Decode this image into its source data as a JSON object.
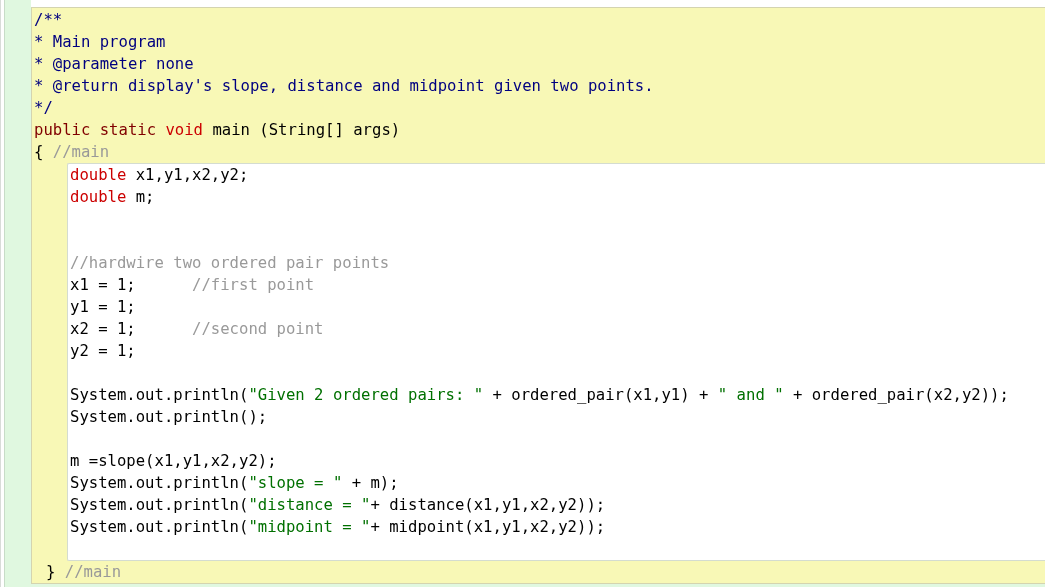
{
  "method": {
    "header": [
      {
        "kind": "code",
        "tokens": [
          {
            "kind": "javadoc",
            "text": "/**"
          }
        ]
      },
      {
        "kind": "code",
        "tokens": [
          {
            "kind": "javadoc",
            "text": "* Main program"
          }
        ]
      },
      {
        "kind": "code",
        "tokens": [
          {
            "kind": "javadoc",
            "text": "* @parameter none"
          }
        ]
      },
      {
        "kind": "code",
        "tokens": [
          {
            "kind": "javadoc",
            "text": "* @return display's slope, distance and midpoint given two points."
          }
        ]
      },
      {
        "kind": "code",
        "tokens": [
          {
            "kind": "javadoc",
            "text": "*/"
          }
        ]
      },
      {
        "kind": "code",
        "tokens": [
          {
            "kind": "modifier",
            "text": "public static "
          },
          {
            "kind": "type",
            "text": "void"
          },
          {
            "kind": "plain",
            "text": " main (String[] args)"
          }
        ]
      },
      {
        "kind": "code",
        "tokens": [
          {
            "kind": "plain",
            "text": "{ "
          },
          {
            "kind": "comment",
            "text": "//main"
          }
        ]
      }
    ],
    "body": [
      {
        "kind": "code",
        "tokens": [
          {
            "kind": "type",
            "text": "double"
          },
          {
            "kind": "plain",
            "text": " x1,y1,x2,y2;"
          }
        ]
      },
      {
        "kind": "code",
        "tokens": [
          {
            "kind": "type",
            "text": "double"
          },
          {
            "kind": "plain",
            "text": " m;"
          }
        ]
      },
      {
        "kind": "blank"
      },
      {
        "kind": "blank"
      },
      {
        "kind": "code",
        "tokens": [
          {
            "kind": "comment",
            "text": "//hardwire two ordered pair points"
          }
        ]
      },
      {
        "kind": "code",
        "tokens": [
          {
            "kind": "plain",
            "text": "x1 = 1;      "
          },
          {
            "kind": "comment",
            "text": "//first point"
          }
        ]
      },
      {
        "kind": "code",
        "tokens": [
          {
            "kind": "plain",
            "text": "y1 = 1;"
          }
        ]
      },
      {
        "kind": "code",
        "tokens": [
          {
            "kind": "plain",
            "text": "x2 = 1;      "
          },
          {
            "kind": "comment",
            "text": "//second point"
          }
        ]
      },
      {
        "kind": "code",
        "tokens": [
          {
            "kind": "plain",
            "text": "y2 = 1;"
          }
        ]
      },
      {
        "kind": "blank"
      },
      {
        "kind": "code",
        "tokens": [
          {
            "kind": "plain",
            "text": "System.out.println("
          },
          {
            "kind": "string",
            "text": "\"Given 2 ordered pairs: \""
          },
          {
            "kind": "plain",
            "text": " + ordered_pair(x1,y1) + "
          },
          {
            "kind": "string",
            "text": "\" and \""
          },
          {
            "kind": "plain",
            "text": " + ordered_pair(x2,y2));"
          }
        ]
      },
      {
        "kind": "code",
        "tokens": [
          {
            "kind": "plain",
            "text": "System.out.println();"
          }
        ]
      },
      {
        "kind": "blank"
      },
      {
        "kind": "code",
        "tokens": [
          {
            "kind": "plain",
            "text": "m =slope(x1,y1,x2,y2);"
          }
        ]
      },
      {
        "kind": "code",
        "tokens": [
          {
            "kind": "plain",
            "text": "System.out.println("
          },
          {
            "kind": "string",
            "text": "\"slope = \""
          },
          {
            "kind": "plain",
            "text": " + m);"
          }
        ]
      },
      {
        "kind": "code",
        "tokens": [
          {
            "kind": "plain",
            "text": "System.out.println("
          },
          {
            "kind": "string",
            "text": "\"distance = \""
          },
          {
            "kind": "plain",
            "text": "+ distance(x1,y1,x2,y2));"
          }
        ]
      },
      {
        "kind": "code",
        "tokens": [
          {
            "kind": "plain",
            "text": "System.out.println("
          },
          {
            "kind": "string",
            "text": "\"midpoint = \""
          },
          {
            "kind": "plain",
            "text": "+ midpoint(x1,y1,x2,y2));"
          }
        ]
      },
      {
        "kind": "blank"
      }
    ],
    "footer": [
      {
        "kind": "code",
        "tokens": [
          {
            "kind": "plain",
            "text": "} "
          },
          {
            "kind": "comment",
            "text": "//main"
          }
        ]
      }
    ]
  }
}
